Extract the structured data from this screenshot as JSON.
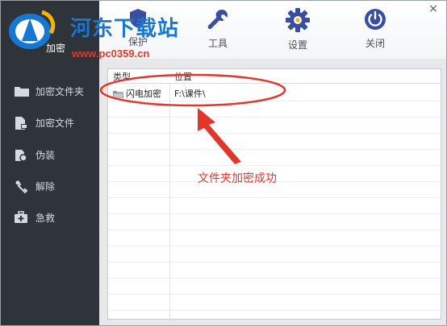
{
  "window": {
    "close_glyph": "×"
  },
  "watermark": {
    "title": "河东下载站",
    "url": "www.pc0359.cn"
  },
  "toolbar": {
    "items": [
      {
        "label": "加密",
        "icon": "lock-icon"
      },
      {
        "label": "保护",
        "icon": "shield-icon"
      },
      {
        "label": "工具",
        "icon": "wrench-icon"
      },
      {
        "label": "设置",
        "icon": "gear-icon"
      },
      {
        "label": "关闭",
        "icon": "power-icon"
      }
    ]
  },
  "sidebar": {
    "items": [
      {
        "label": "加密文件夹",
        "icon": "folder-icon"
      },
      {
        "label": "加密文件",
        "icon": "file-icon"
      },
      {
        "label": "伪装",
        "icon": "disguise-icon"
      },
      {
        "label": "解除",
        "icon": "unlock-icon"
      },
      {
        "label": "急救",
        "icon": "firstaid-icon"
      }
    ]
  },
  "table": {
    "columns": [
      "类型",
      "位置"
    ],
    "rows": [
      {
        "type": "闪电加密",
        "location": "F:\\课件\\"
      }
    ]
  },
  "annotation": {
    "text": "文件夹加密成功",
    "color": "#e0362c"
  },
  "colors": {
    "sidebar_bg": "#2f343b",
    "accent_blue": "#1877d2",
    "annotation_red": "#e0362c"
  }
}
